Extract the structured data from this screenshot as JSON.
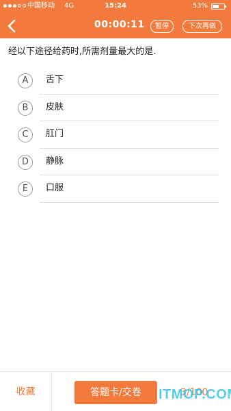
{
  "status_bar": {
    "carrier": "中国移动",
    "network": "4G",
    "time": "15:24",
    "battery_percent": "53%",
    "signal_bars_filled": 3,
    "signal_bars_total": 5
  },
  "nav": {
    "timer": "00:00:11",
    "pause_label": "暂停",
    "next_label": "下次再做",
    "back_icon": "chevron-left-icon"
  },
  "question": {
    "text": "经以下途径给药时,所需剂量最大的是."
  },
  "options": [
    {
      "letter": "A",
      "text": "舌下"
    },
    {
      "letter": "B",
      "text": "皮肤"
    },
    {
      "letter": "C",
      "text": "肛门"
    },
    {
      "letter": "D",
      "text": "静脉"
    },
    {
      "letter": "E",
      "text": "口服"
    }
  ],
  "footer": {
    "favorite_label": "收藏",
    "submit_label": "答题卡/交卷",
    "progress": "3/100"
  },
  "watermark": "ITMOP.COM",
  "colors": {
    "accent": "#f27a3c",
    "watermark": "#28bee6"
  }
}
